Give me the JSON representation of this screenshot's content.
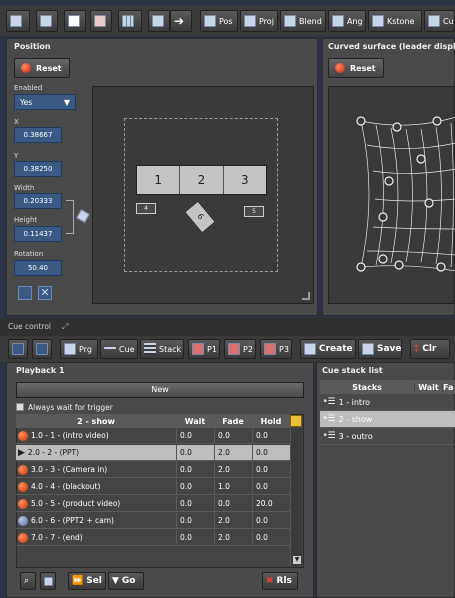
{
  "toolbar": {
    "pos": "Pos",
    "proj": "Proj",
    "blend": "Blend",
    "ang": "Ang",
    "kstone": "Kstone",
    "cu": "Cu"
  },
  "position_panel": {
    "title": "Position",
    "reset_label": "Reset",
    "enabled_label": "Enabled",
    "enabled_value": "Yes",
    "x_label": "X",
    "x_value": "0.38667",
    "y_label": "Y",
    "y_value": "0.38250",
    "width_label": "Width",
    "width_value": "0.20333",
    "height_label": "Height",
    "height_value": "0.11437",
    "rotation_label": "Rotation",
    "rotation_value": "50.40",
    "projectors": [
      "1",
      "2",
      "3"
    ],
    "small_boxes": [
      "4",
      "6",
      "5"
    ]
  },
  "curved_panel": {
    "title": "Curved surface (leader display)",
    "reset_label": "Reset"
  },
  "cue_control": {
    "label": "Cue control",
    "prg": "Prg",
    "cue": "Cue",
    "stack": "Stack",
    "p1": "P1",
    "p2": "P2",
    "p3": "P3",
    "create": "Create",
    "save": "Save",
    "clr": "Clr"
  },
  "playback": {
    "title": "Playback 1",
    "new_label": "New",
    "always_wait": "Always wait for trigger",
    "columns": {
      "name": "2 - show",
      "wait": "Wait",
      "fade": "Fade",
      "hold": "Hold"
    },
    "cues": [
      {
        "name": "1.0 - 1 - (intro video)",
        "wait": "0.0",
        "fade": "0.0",
        "hold": "0.0"
      },
      {
        "name": "2.0 - 2 - (PPT)",
        "wait": "0.0",
        "fade": "2.0",
        "hold": "0.0"
      },
      {
        "name": "3.0 - 3 - (Camera in)",
        "wait": "0.0",
        "fade": "2.0",
        "hold": "0.0"
      },
      {
        "name": "4.0 - 4 - (blackout)",
        "wait": "0.0",
        "fade": "1.0",
        "hold": "0.0"
      },
      {
        "name": "5.0 - 5 - (product video)",
        "wait": "0.0",
        "fade": "0.0",
        "hold": "20.0"
      },
      {
        "name": "6.0 - 6 - (PPT2 + cam)",
        "wait": "0.0",
        "fade": "2.0",
        "hold": "0.0"
      },
      {
        "name": "7.0 - 7 - (end)",
        "wait": "0.0",
        "fade": "2.0",
        "hold": "0.0"
      }
    ],
    "sel_label": "Sel",
    "go_label": "Go",
    "rls_label": "Rls"
  },
  "cue_stack_list": {
    "title": "Cue stack list",
    "columns": {
      "stacks": "Stacks",
      "wait": "Wait",
      "fa": "Fa"
    },
    "stacks": [
      "1 - intro",
      "2 - show",
      "3 - outro"
    ]
  }
}
